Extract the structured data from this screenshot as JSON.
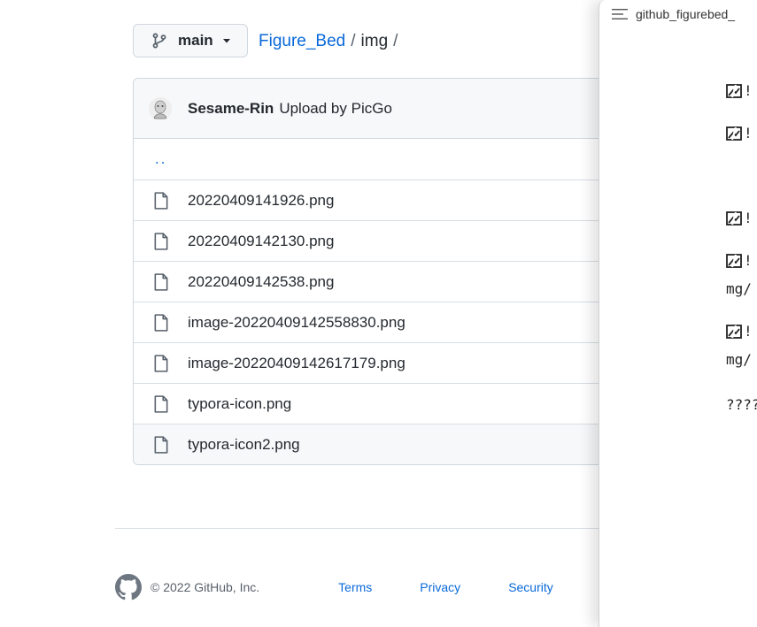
{
  "branch": {
    "label": "main"
  },
  "breadcrumb": {
    "repo": "Figure_Bed",
    "sep1": "/",
    "dir": "img",
    "sep2": "/"
  },
  "commit": {
    "author": "Sesame-Rin",
    "message": "Upload by PicGo"
  },
  "files": {
    "up": "..",
    "items": [
      "20220409141926.png",
      "20220409142130.png",
      "20220409142538.png",
      "image-20220409142558830.png",
      "image-20220409142617179.png",
      "typora-icon.png",
      "typora-icon2.png"
    ]
  },
  "footer": {
    "copyright": "© 2022 GitHub, Inc.",
    "links": {
      "terms": "Terms",
      "privacy": "Privacy",
      "security": "Security"
    }
  },
  "overlay": {
    "title": "github_figurebed_",
    "lines": [
      "!",
      "!",
      "!",
      "!",
      "mg/",
      "!",
      "mg/",
      "????"
    ]
  },
  "colors": {
    "link": "#0969da",
    "border": "#d0d7de",
    "header_bg": "#f6f8fa"
  }
}
